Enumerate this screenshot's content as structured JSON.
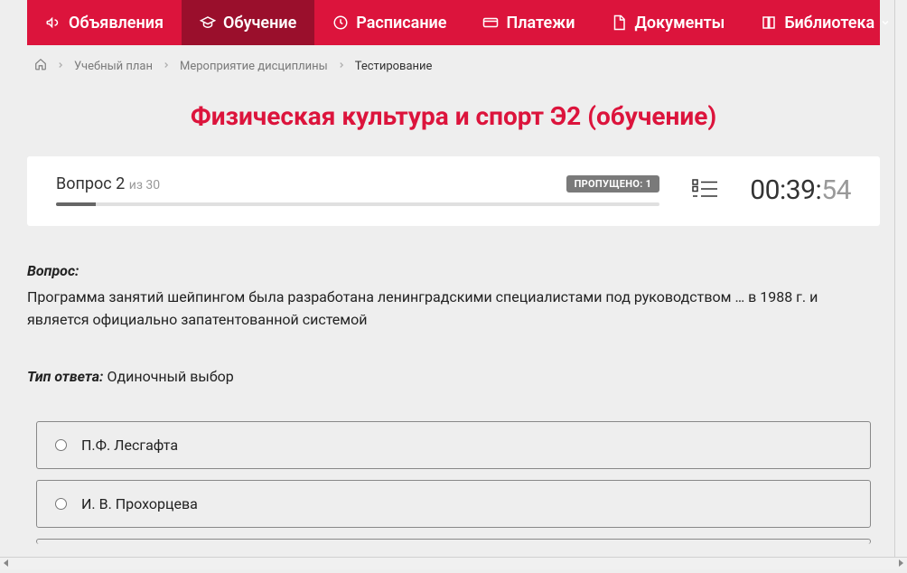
{
  "nav": {
    "items": [
      {
        "label": "Объявления",
        "icon": "megaphone"
      },
      {
        "label": "Обучение",
        "icon": "grad-cap",
        "active": true
      },
      {
        "label": "Расписание",
        "icon": "clock"
      },
      {
        "label": "Платежи",
        "icon": "card"
      },
      {
        "label": "Документы",
        "icon": "document"
      },
      {
        "label": "Библиотека",
        "icon": "book",
        "has_chevron": true
      }
    ]
  },
  "breadcrumb": {
    "items": [
      {
        "label": "Учебный план"
      },
      {
        "label": "Мероприятие дисциплины"
      },
      {
        "label": "Тестирование",
        "current": true
      }
    ]
  },
  "page_title": "Физическая культура и спорт Э2 (обучение)",
  "question_header": {
    "number_word": "Вопрос",
    "number": "2",
    "of_word": "из",
    "total": "30",
    "skipped_label": "ПРОПУЩЕНО: 1",
    "progress_pct": 6.6
  },
  "timer": {
    "mm": "00",
    "colon1": ":",
    "ss_major": "39",
    "colon2": ":",
    "ss_minor": "54"
  },
  "question": {
    "label": "Вопрос:",
    "text": "Программа занятий шейпингом была разработана ленинградскими специалистами под руководством … в 1988 г. и является официально запатентованной системой"
  },
  "answer_type": {
    "label": "Тип ответа:",
    "value": "Одиночный выбор"
  },
  "options": [
    {
      "text": "П.Ф. Лесгафта"
    },
    {
      "text": "И. В. Прохорцева"
    }
  ]
}
